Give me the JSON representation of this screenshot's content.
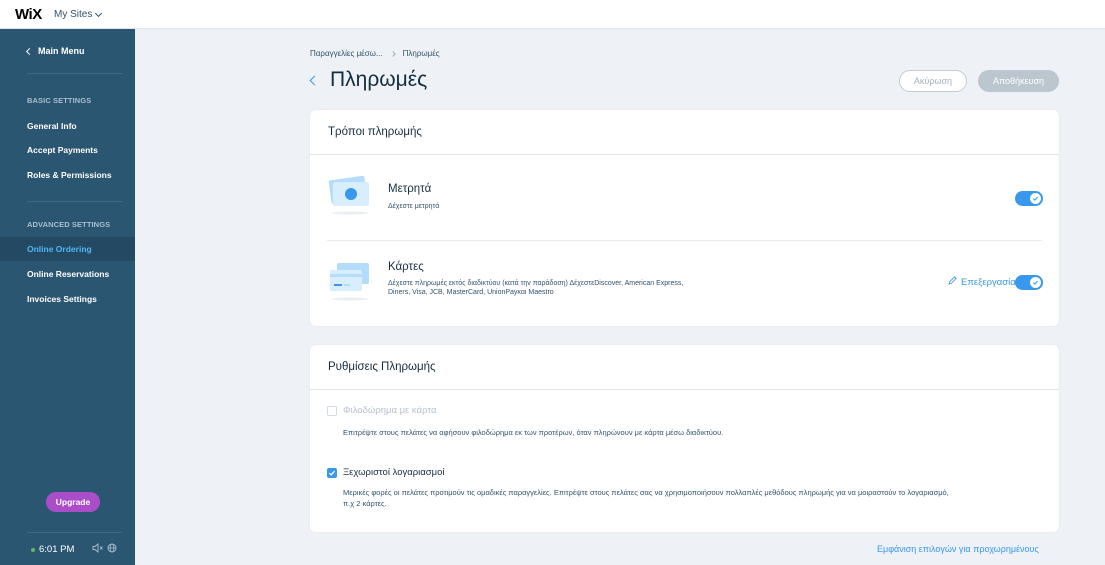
{
  "topbar": {
    "logo": "WiX",
    "my_sites": "My Sites"
  },
  "sidebar": {
    "back_label": "Main Menu",
    "basic_section": "BASIC SETTINGS",
    "basic_items": [
      {
        "label": "General Info"
      },
      {
        "label": "Accept Payments"
      },
      {
        "label": "Roles & Permissions"
      }
    ],
    "advanced_section": "ADVANCED SETTINGS",
    "advanced_items": [
      {
        "label": "Online Ordering",
        "active": true
      },
      {
        "label": "Online Reservations"
      },
      {
        "label": "Invoices Settings"
      }
    ],
    "upgrade_label": "Upgrade",
    "time": "6:01 PM"
  },
  "header": {
    "breadcrumb": [
      "Παραγγελίες μέσω...",
      "Πληρωμές"
    ],
    "title": "Πληρωμές",
    "cancel_label": "Ακύρωση",
    "save_label": "Αποθήκευση"
  },
  "payment_methods": {
    "title": "Τρόποι πληρωμής",
    "cash": {
      "title": "Μετρητά",
      "description": "Δέχεστε μετρητά",
      "enabled": true
    },
    "cards": {
      "title": "Κάρτες",
      "description_line1": "Δέχεστε πληρωμές εκτός διαδικτύου (κατά την παράδοση) ΔέχεστεDiscover, American Express,",
      "description_line2": "Diners, Visa, JCB, MasterCard, UnionPayκαι Maestro",
      "edit_label": "Επεξεργασία",
      "enabled": true
    }
  },
  "payment_settings": {
    "title": "Ρυθμίσεις Πληρωμής",
    "tip": {
      "label": "Φιλοδώρημα με κάρτα",
      "description": "Επιτρέψτε στους πελάτες να αφήσουν φιλοδώρημα εκ των προτέρων, όταν πληρώνουν με κάρτα μέσω διαδικτύου.",
      "checked": false
    },
    "split": {
      "label": "Ξεχωριστοί λογαριασμοί",
      "description_line1": "Μερικές φορές οι πελάτες προτιμούν τις ομαδικές παραγγελίες. Επιτρέψτε στους πελάτες σας να χρησιμοποιήσουν πολλαπλές μεθόδους πληρωμής για να μοιραστούν το λογαριασμό,",
      "description_line2": "π.χ 2 κάρτες.",
      "checked": true
    }
  },
  "advanced_link": "Εμφάνιση επιλογών για προχωρημένους",
  "colors": {
    "accent": "#3899ec",
    "sidebar": "#2b5672",
    "upgrade": "#aa4dc8"
  }
}
